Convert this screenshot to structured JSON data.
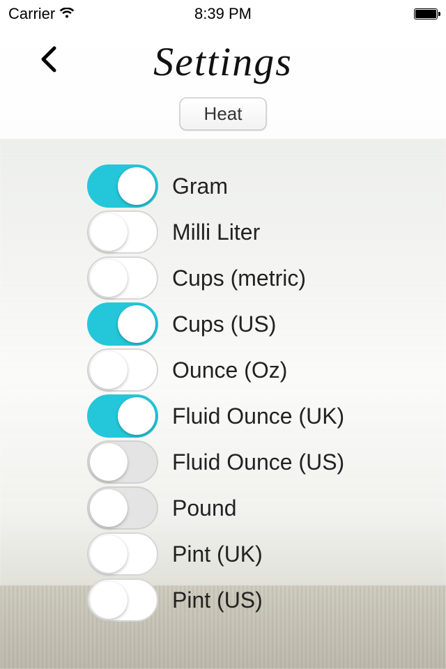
{
  "status": {
    "carrier": "Carrier",
    "time": "8:39 PM"
  },
  "header": {
    "title": "Settings",
    "segment_label": "Heat"
  },
  "units": [
    {
      "label": "Gram",
      "on": true
    },
    {
      "label": "Milli Liter",
      "on": false
    },
    {
      "label": "Cups (metric)",
      "on": false
    },
    {
      "label": "Cups (US)",
      "on": true
    },
    {
      "label": "Ounce (Oz)",
      "on": false
    },
    {
      "label": "Fluid Ounce (UK)",
      "on": true
    },
    {
      "label": "Fluid Ounce (US)",
      "on": false,
      "grey": true
    },
    {
      "label": "Pound",
      "on": false,
      "grey": true
    },
    {
      "label": "Pint (UK)",
      "on": false
    },
    {
      "label": "Pint (US)",
      "on": false
    }
  ]
}
